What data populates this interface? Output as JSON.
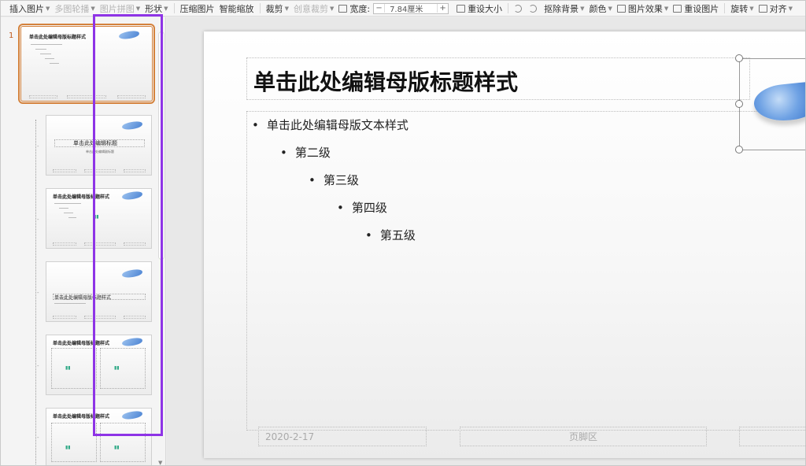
{
  "toolbar": {
    "insert_image": "插入图片",
    "multi_outline": "多图轮播",
    "image_collage": "图片拼图",
    "shape": "形状",
    "compress": "压缩图片",
    "smart_scale": "智能缩放",
    "crop": "裁剪",
    "creative_crop": "创意裁剪",
    "width_label": "宽度:",
    "width_value": "7.84厘米",
    "reset_size": "重设大小",
    "remove_bg": "抠除背景",
    "color": "颜色",
    "image_effect": "图片效果",
    "reset_image": "重设图片",
    "rotate": "旋转",
    "align": "对齐",
    "minus": "−",
    "plus": "+"
  },
  "thumbnails": {
    "first_number": "1",
    "master_title": "单击此处编辑母版标题样式",
    "layout_title": "单击此处编辑标题",
    "layout_subtitle": "单击此处编辑副标题"
  },
  "slide": {
    "title": "单击此处编辑母版标题样式",
    "levels": [
      "单击此处编辑母版文本样式",
      "第二级",
      "第三级",
      "第四级",
      "第五级"
    ],
    "bullet": "•",
    "footer_date": "2020-2-17",
    "footer_center": "页脚区"
  },
  "colors": {
    "selection_orange": "#d4823c",
    "highlight_purple": "#8e34e6",
    "pillow_blue": "#4b83d3"
  }
}
